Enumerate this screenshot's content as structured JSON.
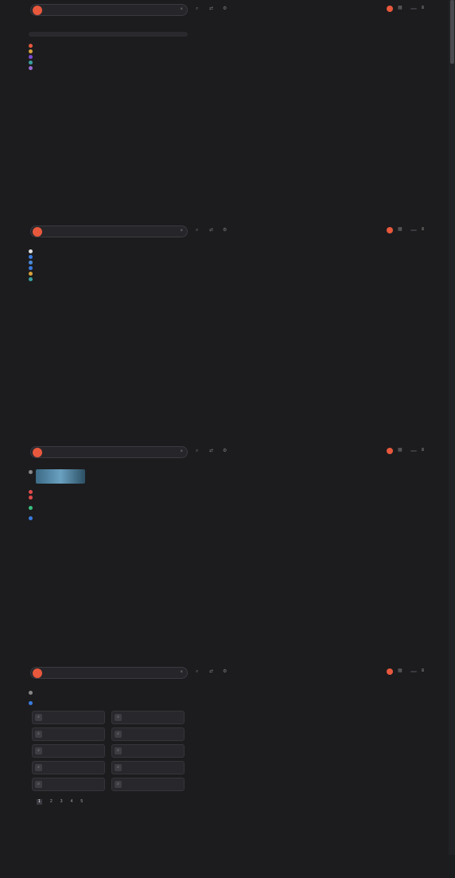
{
  "search": {
    "query": "",
    "logo_letter": "",
    "clear_icon": "close-icon",
    "sign_in": ""
  },
  "tabs": [
    "",
    "",
    "",
    "",
    "",
    "",
    "",
    ""
  ],
  "colors": {
    "accent": "#e8583d",
    "link": "#8ab4f8",
    "url": "#9fd39f",
    "bg": "#1c1c1e"
  },
  "panels": [
    {
      "meta": "",
      "box": {
        "text": "",
        "link": ""
      },
      "results": [
        {
          "fav": "#e8583d",
          "title": "",
          "url": "",
          "snippet": ""
        },
        {
          "fav": "#d8a23a",
          "title": "",
          "url": "",
          "snippet": ""
        },
        {
          "fav": "#7b4bd6",
          "title": "",
          "url": "",
          "snippet": ""
        },
        {
          "fav": "#3aa0a0",
          "title": "",
          "url": "",
          "snippet": ""
        },
        {
          "fav": "#9a6bd0",
          "title": "",
          "url": "",
          "snippet": ""
        }
      ]
    },
    {
      "results": [
        {
          "fav": "#ddd",
          "title": "",
          "url": "",
          "snippet": ""
        },
        {
          "fav": "#3a7be0",
          "title": "",
          "url": "",
          "snippet": ""
        },
        {
          "fav": "#4a8ad8",
          "title": "",
          "url": "",
          "snippet": ""
        },
        {
          "fav": "#3a7be0",
          "title": "",
          "url": "",
          "snippet": ""
        },
        {
          "fav": "#d8a23a",
          "title": "",
          "url": "",
          "snippet": ""
        },
        {
          "fav": "#3aa0a0",
          "title": "",
          "url": "",
          "snippet": ""
        }
      ]
    },
    {
      "results": [
        {
          "fav": "#888",
          "title": "",
          "url": "",
          "snippet": ""
        },
        {
          "fav": "#e04a4a",
          "title": "",
          "url": "",
          "snippet": ""
        },
        {
          "fav": "#e04a4a",
          "title": "",
          "url": "",
          "snippet": "",
          "links": [
            "",
            "",
            "",
            ""
          ]
        },
        {
          "fav": "#3ac080",
          "title": "",
          "url": "",
          "snippet": "",
          "links": [
            "",
            "",
            "",
            ""
          ]
        },
        {
          "fav": "#3a7be0",
          "title": "",
          "url": "",
          "snippet": ""
        }
      ]
    },
    {
      "results": [
        {
          "fav": "#888",
          "title": "",
          "url": "",
          "snippet": "",
          "links": [
            "",
            "",
            ""
          ]
        },
        {
          "fav": "#3a7be0",
          "title": "",
          "url": "",
          "snippet": "",
          "links": [
            "",
            "",
            "",
            ""
          ]
        }
      ],
      "people_title": "",
      "chips": [
        "",
        "",
        "",
        "",
        "",
        "",
        "",
        "",
        "",
        ""
      ],
      "pagination": {
        "pages": [
          "1",
          "2",
          "3",
          "4",
          "5"
        ],
        "next": ""
      }
    }
  ]
}
